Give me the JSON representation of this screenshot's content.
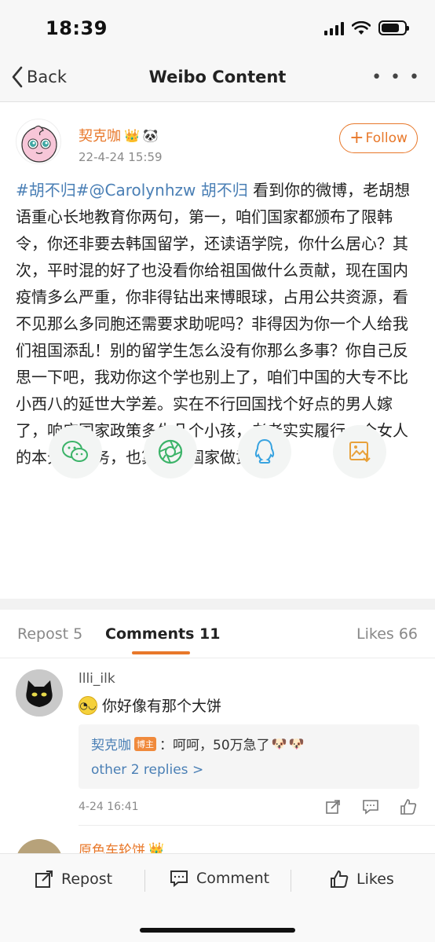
{
  "status_bar": {
    "time": "18:39"
  },
  "nav": {
    "back_label": "Back",
    "title": "Weibo Content"
  },
  "post": {
    "author": "契克咖",
    "timestamp": "22-4-24 15:59",
    "follow_label": "Follow",
    "text_links": "#胡不归#@Carolynhzw 胡不归",
    "text_body": " 看到你的微博，老胡想语重心长地教育你两句，第一，咱们国家都颁布了限韩令，你还非要去韩国留学，还读语学院，你什么居心？其次，平时混的好了也没看你给祖国做什么贡献，现在国内疫情多么严重，你非得钻出来博眼球，占用公共资源，看不见那么多同胞还需要求助呢吗？非得因为你一个人给我们祖国添乱！别的留学生怎么没有你那么多事？你自己反思一下吧，我劝你这个学也别上了，咱们中国的大专不比小西八的延世大学差。实在不行回国找个好点的男人嫁了，响应国家政策多生几个小孩，老老实实履行一个女人的本分和义务，也算是为国家做贡献了！"
  },
  "share_icons": [
    "wechat-icon",
    "moments-icon",
    "qq-icon",
    "save-image-icon"
  ],
  "tabs": {
    "repost": "Repost 5",
    "comments": "Comments 11",
    "likes": "Likes 66"
  },
  "comments": [
    {
      "user": "llli_ilk",
      "text": "你好像有那个大饼",
      "reply": {
        "author": "契克咖",
        "badge": "博主",
        "text": "：呵呵，50万急了",
        "more": "other 2 replies >"
      },
      "time": "4-24 16:41"
    },
    {
      "user": "原色车轮饼"
    }
  ],
  "bottom_bar": {
    "repost": "Repost",
    "comment": "Comment",
    "likes": "Likes"
  },
  "colors": {
    "accent": "#e8782a",
    "link": "#4a7fb5"
  }
}
